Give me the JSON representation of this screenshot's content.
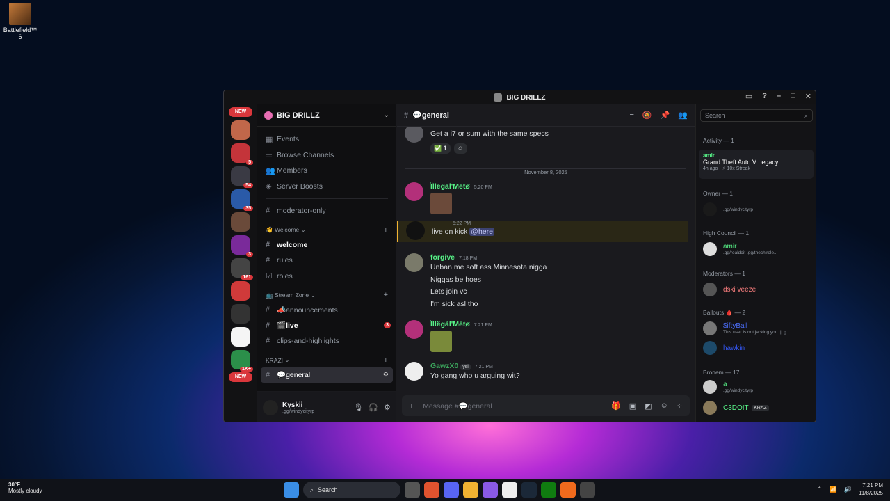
{
  "desktop": {
    "icon_label": "Battlefield™ 6"
  },
  "window": {
    "title": "BIG DRILLZ"
  },
  "guilds": {
    "new_top": "NEW",
    "new_bottom": "NEW",
    "badges": [
      "",
      "5",
      "54",
      "35",
      "",
      "3",
      "161",
      "",
      "",
      "",
      "1K+"
    ]
  },
  "server": {
    "name": "BIG DRILLZ"
  },
  "channels": {
    "nav": [
      {
        "label": "Events",
        "icon": "calendar-icon"
      },
      {
        "label": "Browse Channels",
        "icon": "browse-icon"
      },
      {
        "label": "Members",
        "icon": "members-icon"
      },
      {
        "label": "Server Boosts",
        "icon": "boost-icon"
      }
    ],
    "moderator": "moderator-only",
    "cat_welcome": "👋 Welcome",
    "welcome": "welcome",
    "rules": "rules",
    "roles": "roles",
    "cat_stream": "📺 Stream Zone",
    "announcements": "📣announcements",
    "live": "🎬live",
    "live_badge": "3",
    "clips": "clips-and-highlights",
    "cat_krazi": "KRAZI",
    "general": "💬general"
  },
  "user": {
    "name": "Kyskii",
    "status": ".gg/windycityrp"
  },
  "chat": {
    "channel": "💬general",
    "date": "November 8, 2025",
    "m0_text": "Get a i7 or sum with the same specs",
    "m0_react_count": "1",
    "m1_author": "Ïllëgäl'Mëtø",
    "m1_time": "5:20 PM",
    "m2_time": "5:22 PM",
    "m2_text": "live on kick",
    "m2_mention": "@here",
    "m3_author": "forgive",
    "m3_time": "7:18 PM",
    "m3_lines": [
      "Unban me  soft ass Minnesota nigga",
      "Niggas be hoes",
      "Lets join vc",
      "I'm sick asl tho"
    ],
    "m4_author": "Ïllëgäl'Mëtø",
    "m4_time": "7:21 PM",
    "m5_author": "GawzX0",
    "m5_tag": "ysl",
    "m5_time": "7:21 PM",
    "m5_text": "Yo gang who u arguing wit?",
    "composer_placeholder": "Message #💬general"
  },
  "members": {
    "search_placeholder": "Search",
    "activity_header": "Activity — 1",
    "act_user": "amir",
    "act_game": "Grand Theft Auto V Legacy",
    "act_meta": "4h ago · ⚡ 10x Streak",
    "owner_header": "Owner — 1",
    "owner_status": ".gg/windycityrp",
    "hc_header": "High Council — 1",
    "hc_name": "amir",
    "hc_status": ".gg/realdoit .gg/thechirole...",
    "mod_header": "Moderators — 1",
    "mod_name": "dski veeze",
    "ballouts_header": "Ballouts 🩸 — 2",
    "b1_name": "$iftyBall",
    "b1_status": "This user is not jacking you. | .g...",
    "b2_name": "hawkin",
    "bronem_header": "Bronem — 17",
    "r1_name": "a",
    "r1_status": ".gg/windycityrp",
    "r2_name": "C3DOIT",
    "r2_tag": "KRAZ"
  },
  "taskbar": {
    "temp": "30°F",
    "weather": "Mostly cloudy",
    "search": "Search",
    "time": "7:21 PM",
    "date": "11/8/2025",
    "discord_badge": "9+"
  },
  "colors": {
    "accent": "#5865f2",
    "danger": "#da373c",
    "online": "#23a55a",
    "mention_bg": "#3c4270"
  }
}
